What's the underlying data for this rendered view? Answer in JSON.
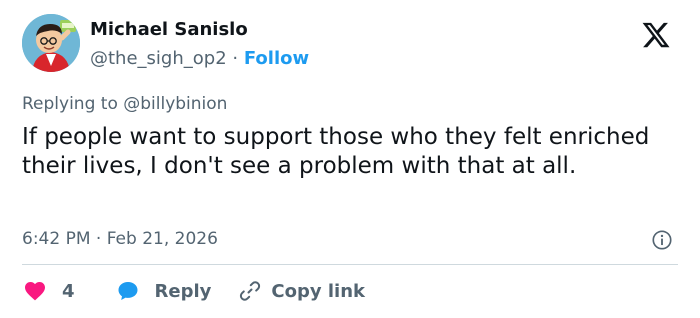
{
  "author": {
    "name": "Michael Sanislo",
    "handle": "@the_sigh_op2",
    "separator": "·",
    "follow_label": "Follow"
  },
  "reply_to": {
    "prefix": "Replying to",
    "mention": "@billybinion"
  },
  "tweet": {
    "text": "If people want to support those who they felt enriched their lives, I don't see a problem with that at all.",
    "timestamp": "6:42 PM · Feb 21, 2026"
  },
  "actions": {
    "like_count": "4",
    "reply_label": "Reply",
    "copy_label": "Copy link"
  },
  "colors": {
    "accent": "#1d9bf0",
    "like": "#f91880",
    "text": "#0f1419",
    "muted": "#536471",
    "divider": "#cfd9de"
  },
  "icons": {
    "logo": "x-logo-icon",
    "info": "info-icon",
    "like": "heart-icon",
    "reply": "speech-bubble-icon",
    "copy": "link-icon"
  }
}
